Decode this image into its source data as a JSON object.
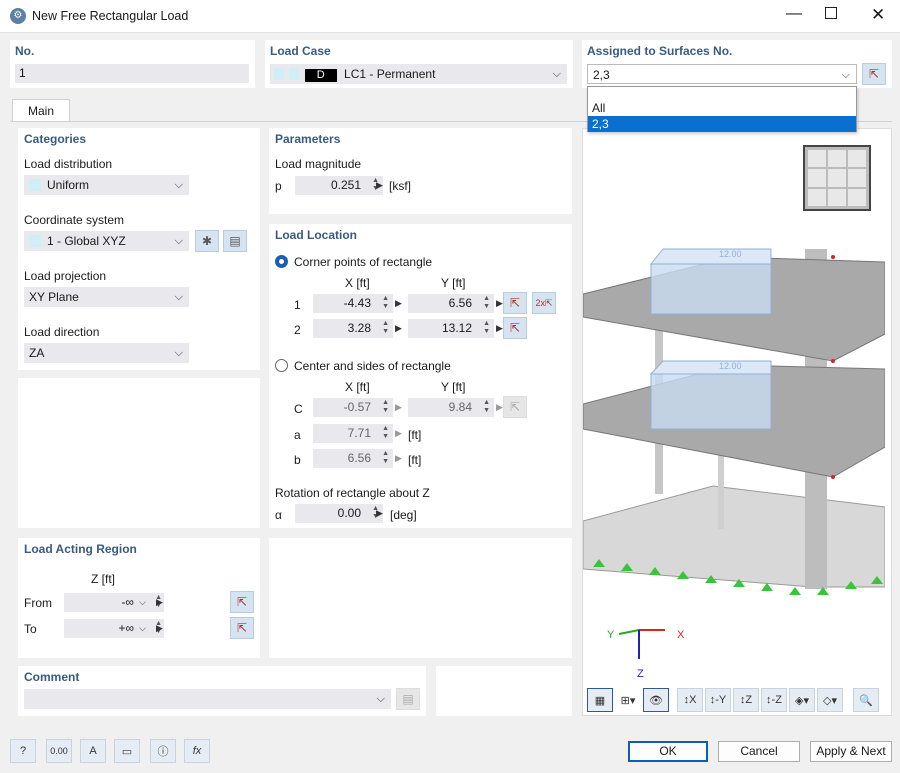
{
  "window": {
    "title": "New Free Rectangular Load"
  },
  "top": {
    "no_label": "No.",
    "no_value": "1",
    "load_case_label": "Load Case",
    "load_case_tag": "D",
    "load_case_value": "LC1 - Permanent",
    "assigned_label": "Assigned to Surfaces No.",
    "assigned_value": "2,3",
    "dropdown_options": [
      "All",
      "2,3"
    ]
  },
  "tab": {
    "main": "Main"
  },
  "categories": {
    "header": "Categories",
    "load_distribution_label": "Load distribution",
    "load_distribution_value": "Uniform",
    "coord_label": "Coordinate system",
    "coord_value": "1 - Global XYZ",
    "projection_label": "Load projection",
    "projection_value": "XY Plane",
    "direction_label": "Load direction",
    "direction_value": "ZA"
  },
  "parameters": {
    "header": "Parameters",
    "magnitude_label": "Load magnitude",
    "p_label": "p",
    "p_value": "0.251",
    "p_unit": "[ksf]"
  },
  "location": {
    "header": "Load Location",
    "corner_label": "Corner points of rectangle",
    "x_header": "X [ft]",
    "y_header": "Y [ft]",
    "row1": {
      "label": "1",
      "x": "-4.43",
      "y": "6.56"
    },
    "row2": {
      "label": "2",
      "x": "3.28",
      "y": "13.12"
    },
    "center_label": "Center and sides of rectangle",
    "x_header2": "X [ft]",
    "y_header2": "Y [ft]",
    "c": {
      "label": "C",
      "x": "-0.57",
      "y": "9.84"
    },
    "a": {
      "label": "a",
      "value": "7.71",
      "unit": "[ft]"
    },
    "b": {
      "label": "b",
      "value": "6.56",
      "unit": "[ft]"
    },
    "rotation_label": "Rotation of rectangle about Z",
    "alpha_label": "α",
    "alpha_value": "0.00",
    "alpha_unit": "[deg]"
  },
  "region": {
    "header": "Load Acting Region",
    "z_header": "Z [ft]",
    "from_label": "From",
    "from_value": "-∞",
    "to_label": "To",
    "to_value": "+∞"
  },
  "comment": {
    "header": "Comment",
    "value": ""
  },
  "viewport": {
    "dim_label_1": "12.00",
    "dim_label_2": "12.00",
    "axis_x": "X",
    "axis_y": "Y",
    "axis_z": "Z"
  },
  "footer": {
    "ok": "OK",
    "cancel": "Cancel",
    "apply_next": "Apply & Next"
  },
  "colors": {
    "accent": "#1a5fb4",
    "header_text": "#3a5a80",
    "selection": "#0a70d0"
  }
}
